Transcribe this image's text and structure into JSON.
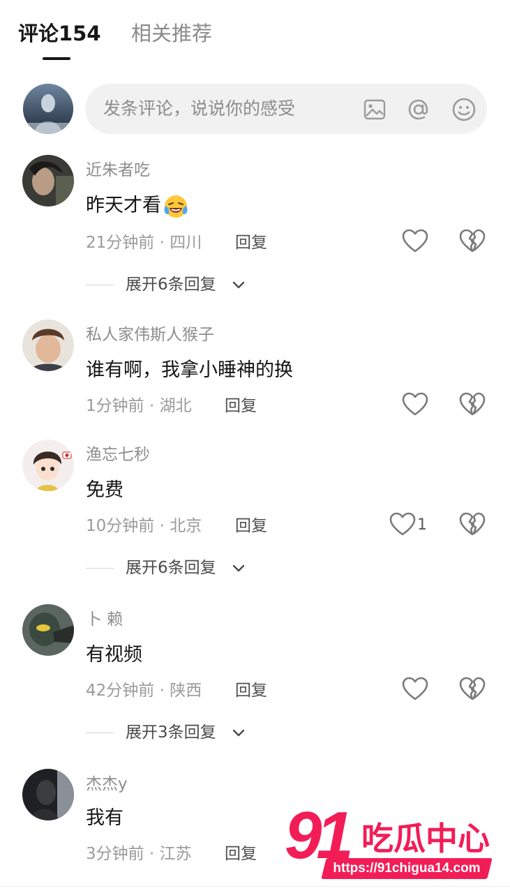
{
  "tabs": {
    "comments_label": "评论154",
    "related_label": "相关推荐"
  },
  "input": {
    "placeholder": "发条评论，说说你的感受",
    "icons": [
      "image-icon",
      "at-icon",
      "emoji-icon"
    ]
  },
  "reply_label": "回复",
  "comments": [
    {
      "username": "近朱者吃",
      "content": "昨天才看",
      "content_emoji": "crying-laughing-emoji",
      "time": "21分钟前",
      "location": "四川",
      "likes": "",
      "expand": "展开6条回复"
    },
    {
      "username": "私人家伟斯人猴子",
      "content": "谁有啊，我拿小睡神的换",
      "time": "1分钟前",
      "location": "湖北",
      "likes": ""
    },
    {
      "username": "渔忘七秒",
      "content": "免费",
      "time": "10分钟前",
      "location": "北京",
      "likes": "1",
      "expand": "展开6条回复"
    },
    {
      "username": "卜 赖",
      "content": "有视频",
      "time": "42分钟前",
      "location": "陕西",
      "likes": "",
      "expand": "展开3条回复"
    },
    {
      "username": "杰杰y",
      "content": "我有",
      "time": "3分钟前",
      "location": "江苏",
      "likes": ""
    }
  ],
  "watermark": {
    "number": "91",
    "name": "吃瓜中心",
    "url": "https://91chigua14.com"
  },
  "colors": {
    "text_primary": "#151515",
    "text_secondary": "#8d8d8d",
    "input_bg": "#f1f1f1",
    "watermark": "#f21d57"
  }
}
